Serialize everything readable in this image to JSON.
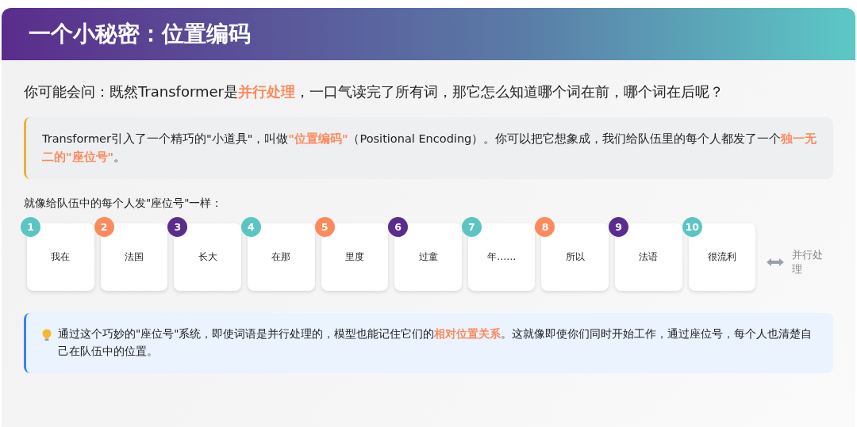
{
  "title": "一个小秘密：位置编码",
  "question": "你可能会问：既然Transformer是**并行处理**，一口气读完了所有词，那它怎么知道哪个词在前，哪个词在后呢？",
  "explanation": "Transformer引入了一个精巧的\"小道具\"，叫做**\"位置编码\"**（Positional Encoding）。你可以把它想象成，我们给队伍里的每个人都发了一个**独一无二的\"座位号\"**。",
  "sequence_label": "就像给队伍中的每个人发\"座位号\"一样：",
  "tokens": [
    {
      "number": "1",
      "word": "我在",
      "color": "#5cc5c2"
    },
    {
      "number": "2",
      "word": "法国",
      "color": "#fd8a5c"
    },
    {
      "number": "3",
      "word": "长大",
      "color": "#5a2d8c"
    },
    {
      "number": "4",
      "word": "在那",
      "color": "#5cc5c2"
    },
    {
      "number": "5",
      "word": "里度",
      "color": "#fd8a5c"
    },
    {
      "number": "6",
      "word": "过童",
      "color": "#5a2d8c"
    },
    {
      "number": "7",
      "word": "年……",
      "color": "#5cc5c2"
    },
    {
      "number": "8",
      "word": "所以",
      "color": "#fd8a5c"
    },
    {
      "number": "9",
      "word": "法语",
      "color": "#5a2d8c"
    },
    {
      "number": "10",
      "word": "很流利",
      "color": "#5cc5c2"
    }
  ],
  "parallel_label": "并行处理",
  "tip": "通过这个巧妙的\"座位号\"系统，即使词语是并行处理的，模型也能记住它们的**相对位置关系**。这就像即使你们同时开始工作，通过座位号，每个人也清楚自己在队伍中的位置。"
}
